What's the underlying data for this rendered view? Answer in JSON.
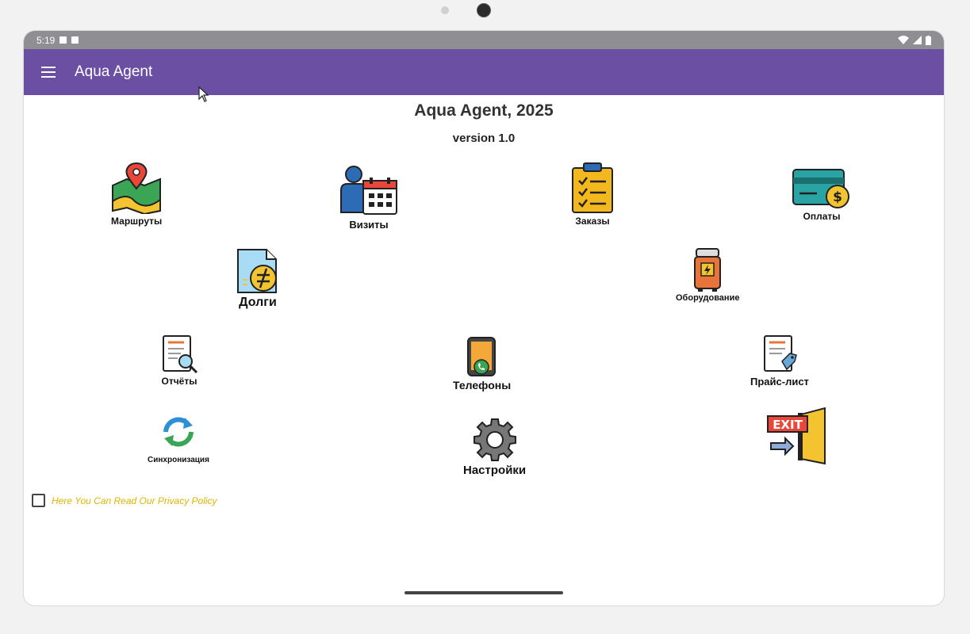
{
  "status_bar": {
    "time": "5:19"
  },
  "app_bar": {
    "title": "Aqua Agent"
  },
  "heading": {
    "title": "Aqua Agent, 2025",
    "version": "version 1.0"
  },
  "menu": {
    "routes": "Маршруты",
    "visits": "Визиты",
    "orders": "Заказы",
    "payments": "Оплаты",
    "debts": "Долги",
    "equipment": "Оборудование",
    "reports": "Отчёты",
    "phones": "Телефоны",
    "price_list": "Прайс-лист",
    "sync": "Синхронизация",
    "settings": "Настройки",
    "exit_sign": "EXIT"
  },
  "privacy": {
    "label": "Here You Can Read Our Privacy Policy",
    "checked": false
  },
  "colors": {
    "app_bar": "#6a4fa3",
    "status_bar": "#8e8e93",
    "privacy_text": "#e0b400"
  }
}
